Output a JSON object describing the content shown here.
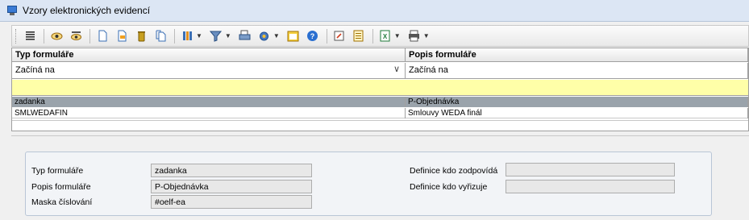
{
  "window": {
    "title": "Vzory elektronických evidencí"
  },
  "toolbar": {
    "buttons": [
      "list-icon",
      "eye-icon",
      "eye-dark-icon",
      "new-document-icon",
      "edit-document-icon",
      "delete-icon",
      "copy-document-icon",
      "columns-icon",
      "filter-icon",
      "print-preview-icon",
      "settings-icon",
      "calendar-icon",
      "help-icon",
      "edit-icon",
      "report-icon",
      "excel-icon",
      "printer-icon"
    ]
  },
  "grid": {
    "columns": [
      "Typ formuláře",
      "Popis formuláře"
    ],
    "filters": [
      "Začíná na",
      "Začíná na"
    ],
    "rows": [
      {
        "type": "zadanka",
        "description": "P-Objednávka",
        "selected": true
      },
      {
        "type": "SMLWEDAFIN",
        "description": "Smlouvy WEDA finál",
        "selected": false
      }
    ]
  },
  "detail": {
    "type_label": "Typ formuláře",
    "type_value": "zadanka",
    "desc_label": "Popis formuláře",
    "desc_value": "P-Objednávka",
    "mask_label": "Maska číslování",
    "mask_value": "#oelf-ea",
    "responds_label": "Definice kdo zodpovídá",
    "responds_value": "",
    "handles_label": "Definice kdo vyřizuje",
    "handles_value": ""
  },
  "colors": {
    "selected_row": "#9aa3ab",
    "new_row": "#ffffa8",
    "title_bar": "#dce6f4"
  }
}
